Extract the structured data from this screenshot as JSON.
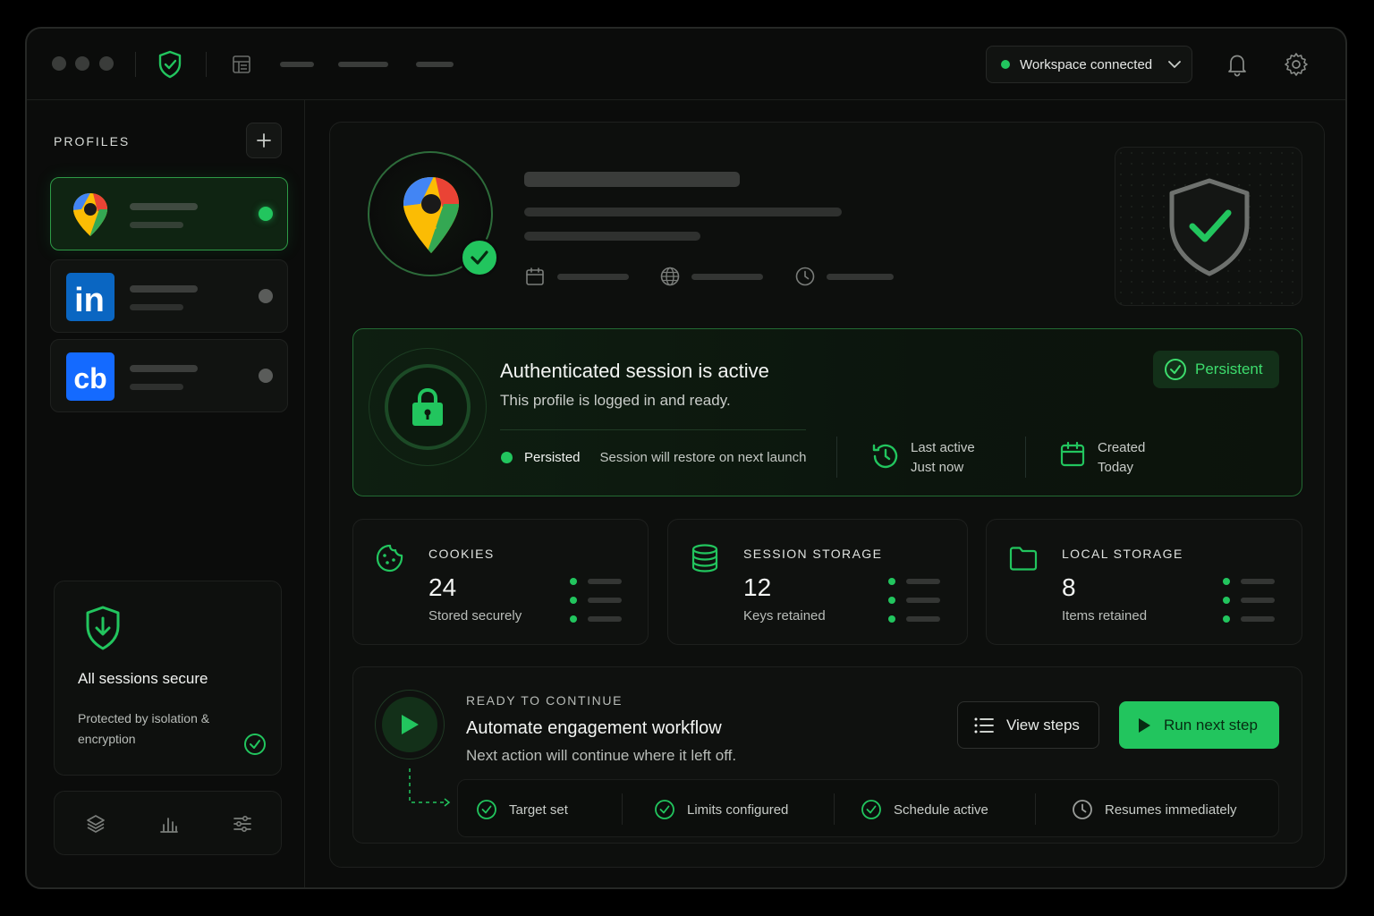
{
  "topbar": {
    "workspace_status": "Workspace connected",
    "icons": [
      "shield-check-icon",
      "layout-icon",
      "bell-icon",
      "gear-icon"
    ]
  },
  "sidebar": {
    "title": "PROFILES",
    "profiles": [
      {
        "app": "Google Maps",
        "icon": "google-maps-pin-icon",
        "status": "active"
      },
      {
        "app": "LinkedIn",
        "icon": "linkedin-icon",
        "logo_text": "in",
        "status": "inactive"
      },
      {
        "app": "Crunchbase",
        "icon": "crunchbase-icon",
        "logo_text": "cb",
        "status": "inactive"
      }
    ],
    "secure_card": {
      "title": "All sessions secure",
      "subtitle": "Protected by isolation & encryption"
    },
    "tools": [
      "layers-icon",
      "bar-chart-icon",
      "sliders-icon"
    ]
  },
  "session": {
    "title": "Authenticated session is active",
    "subtitle": "This profile is logged in and ready.",
    "badge": "Persistent",
    "persisted_label": "Persisted",
    "persisted_desc": "Session will restore on next launch",
    "last_active_label": "Last active",
    "last_active_value": "Just now",
    "created_label": "Created",
    "created_value": "Today"
  },
  "storage": [
    {
      "label": "COOKIES",
      "value": "24",
      "sub": "Stored securely",
      "icon": "cookie-icon"
    },
    {
      "label": "SESSION STORAGE",
      "value": "12",
      "sub": "Keys retained",
      "icon": "database-icon"
    },
    {
      "label": "LOCAL STORAGE",
      "value": "8",
      "sub": "Items retained",
      "icon": "folder-icon"
    }
  ],
  "workflow": {
    "kicker": "READY TO CONTINUE",
    "title": "Automate engagement workflow",
    "subtitle": "Next action will continue where it left off.",
    "view_steps": "View steps",
    "run_next": "Run next step",
    "checks": [
      "Target set",
      "Limits configured",
      "Schedule active",
      "Resumes immediately"
    ]
  },
  "colors": {
    "accent": "#22c55e",
    "background": "#0b0c0b",
    "panel": "#0f110f"
  }
}
